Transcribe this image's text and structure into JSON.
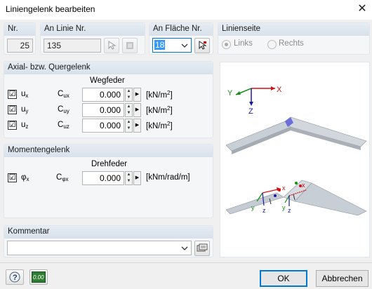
{
  "window": {
    "title": "Liniengelenk bearbeiten",
    "close_glyph": "✕"
  },
  "nr": {
    "label": "Nr.",
    "value": "25"
  },
  "an_linie": {
    "label": "An Linie Nr.",
    "value": "135"
  },
  "an_flaeche": {
    "label": "An Fläche Nr.",
    "value": "18"
  },
  "linienseite": {
    "label": "Linienseite",
    "links": "Links",
    "rechts": "Rechts",
    "selected": "Links"
  },
  "axial": {
    "header": "Axial- bzw. Quergelenk",
    "column_title": "Wegfeder",
    "rows": [
      {
        "check": "☑",
        "u": "u",
        "u_sub": "x",
        "c": "C",
        "c_sub": "ux",
        "value": "0.000",
        "unit": "[kN/m",
        "unit_sup": "2",
        "unit_end": "]"
      },
      {
        "check": "☑",
        "u": "u",
        "u_sub": "y",
        "c": "C",
        "c_sub": "uy",
        "value": "0.000",
        "unit": "[kN/m",
        "unit_sup": "2",
        "unit_end": "]"
      },
      {
        "check": "☑",
        "u": "u",
        "u_sub": "z",
        "c": "C",
        "c_sub": "uz",
        "value": "0.000",
        "unit": "[kN/m",
        "unit_sup": "2",
        "unit_end": "]"
      }
    ]
  },
  "moment": {
    "header": "Momentengelenk",
    "column_title": "Drehfeder",
    "row": {
      "check": "☑",
      "u": "φ",
      "u_sub": "x",
      "c": "C",
      "c_sub": "φx",
      "value": "0.000",
      "unit": "[kNm/rad/m]"
    }
  },
  "kommentar": {
    "header": "Kommentar",
    "value": ""
  },
  "diagram": {
    "axis_x": "X",
    "axis_y": "Y",
    "axis_z": "Z",
    "small_x": "x",
    "small_y": "y",
    "small_z": "z"
  },
  "footer": {
    "calc_label": "0.00",
    "ok": "OK",
    "cancel": "Abbrechen"
  },
  "colors": {
    "accent": "#0078d7",
    "group_header": "#dde5ee",
    "selection": "#3399ff"
  }
}
